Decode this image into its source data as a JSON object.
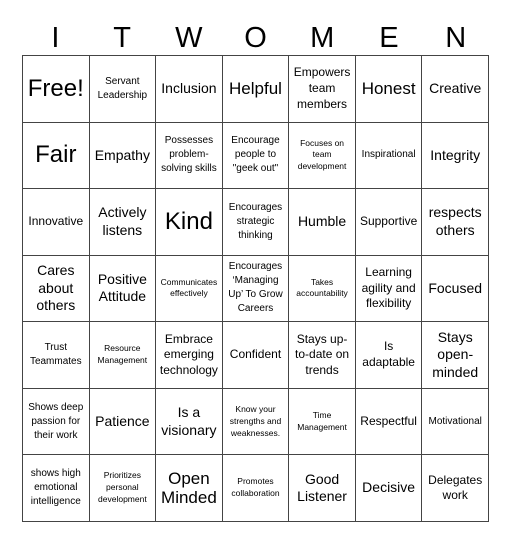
{
  "title_letters": [
    "I",
    "T",
    "W",
    "O",
    "M",
    "E",
    "N"
  ],
  "rows": [
    [
      {
        "text": "Free!",
        "size": "xl"
      },
      {
        "text": "Servant Leadership",
        "size": "xs"
      },
      {
        "text": "Inclusion",
        "size": "m"
      },
      {
        "text": "Helpful",
        "size": "l"
      },
      {
        "text": "Empowers team members",
        "size": "s"
      },
      {
        "text": "Honest",
        "size": "l"
      },
      {
        "text": "Creative",
        "size": "m"
      }
    ],
    [
      {
        "text": "Fair",
        "size": "xl"
      },
      {
        "text": "Empathy",
        "size": "m"
      },
      {
        "text": "Possesses problem-solving skills",
        "size": "xs"
      },
      {
        "text": "Encourage people to \"geek out\"",
        "size": "xs"
      },
      {
        "text": "Focuses on team development",
        "size": "xxs"
      },
      {
        "text": "Inspirational",
        "size": "xs"
      },
      {
        "text": "Integrity",
        "size": "m"
      }
    ],
    [
      {
        "text": "Innovative",
        "size": "s"
      },
      {
        "text": "Actively listens",
        "size": "m"
      },
      {
        "text": "Kind",
        "size": "xl"
      },
      {
        "text": "Encourages strategic thinking",
        "size": "xs"
      },
      {
        "text": "Humble",
        "size": "m"
      },
      {
        "text": "Supportive",
        "size": "s"
      },
      {
        "text": "respects others",
        "size": "m"
      }
    ],
    [
      {
        "text": "Cares about others",
        "size": "m"
      },
      {
        "text": "Positive Attitude",
        "size": "m"
      },
      {
        "text": "Communicates effectively",
        "size": "xxs"
      },
      {
        "text": "Encourages ‘Managing Up’ To Grow Careers",
        "size": "xs"
      },
      {
        "text": "Takes accountability",
        "size": "xxs"
      },
      {
        "text": "Learning agility and flexibility",
        "size": "s"
      },
      {
        "text": "Focused",
        "size": "m"
      }
    ],
    [
      {
        "text": "Trust Teammates",
        "size": "xs"
      },
      {
        "text": "Resource Management",
        "size": "xxs"
      },
      {
        "text": "Embrace emerging technology",
        "size": "s"
      },
      {
        "text": "Confident",
        "size": "s"
      },
      {
        "text": "Stays up-to-date on trends",
        "size": "s"
      },
      {
        "text": "Is adaptable",
        "size": "s"
      },
      {
        "text": "Stays open-minded",
        "size": "m"
      }
    ],
    [
      {
        "text": "Shows deep passion for their work",
        "size": "xs"
      },
      {
        "text": "Patience",
        "size": "m"
      },
      {
        "text": "Is a visionary",
        "size": "m"
      },
      {
        "text": "Know your strengths and weaknesses.",
        "size": "xxs"
      },
      {
        "text": "Time Management",
        "size": "xxs"
      },
      {
        "text": "Respectful",
        "size": "s"
      },
      {
        "text": "Motivational",
        "size": "xs"
      }
    ],
    [
      {
        "text": "shows high emotional intelligence",
        "size": "xs"
      },
      {
        "text": "Prioritizes personal development",
        "size": "xxs"
      },
      {
        "text": "Open Minded",
        "size": "l"
      },
      {
        "text": "Promotes collaboration",
        "size": "xxs"
      },
      {
        "text": "Good Listener",
        "size": "m"
      },
      {
        "text": "Decisive",
        "size": "m"
      },
      {
        "text": "Delegates work",
        "size": "s"
      }
    ]
  ]
}
